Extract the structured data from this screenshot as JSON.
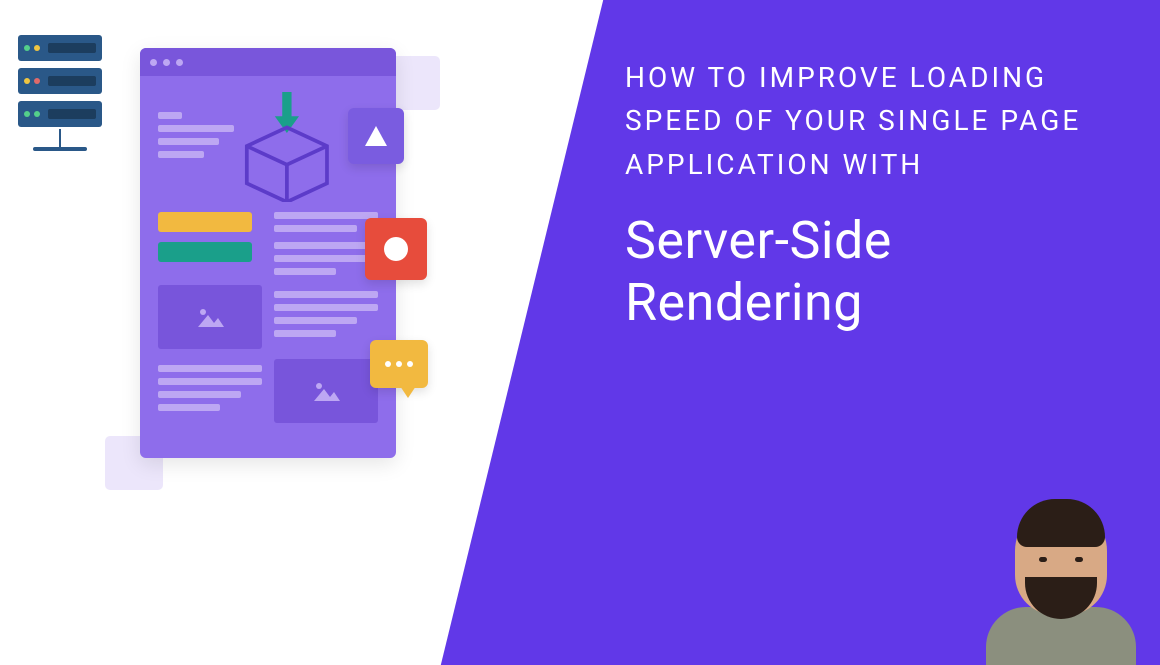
{
  "colors": {
    "primary_purple": "#6138e8",
    "mockup_purple": "#8e6deb",
    "server_blue": "#2a5888",
    "accent_yellow": "#f2b940",
    "accent_teal": "#1a9f8a",
    "accent_red": "#e74c3c"
  },
  "heading": {
    "subtitle": "HOW TO IMPROVE LOADING SPEED OF YOUR SINGLE PAGE APPLICATION WITH",
    "title": "Server-Side Rendering"
  },
  "illustration": {
    "server_rack_icon": "server-rack-icon",
    "mockup_icon": "website-mockup-icon",
    "cube_icon": "cube-download-icon",
    "triangle_chip_icon": "triangle-icon",
    "circle_chip_icon": "circle-icon",
    "chat_chip_icon": "chat-bubble-icon"
  },
  "avatar": {
    "label": "author-portrait"
  }
}
